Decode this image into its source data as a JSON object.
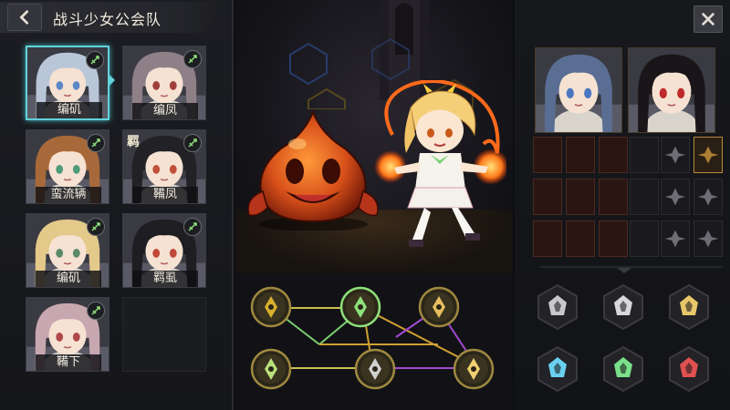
{
  "header": {
    "title": "战斗少女公会队"
  },
  "roster": [
    {
      "name": "编矶",
      "hair": "#b9c6d8",
      "eyes": "#5a88c8",
      "selected": true
    },
    {
      "name": "编凤",
      "hair": "#8f8088",
      "eyes": "#a0403a"
    },
    {
      "name": "蛮流辆",
      "hair": "#a8693a",
      "eyes": "#4e9b7a"
    },
    {
      "name": "鞴凤",
      "tag": "羁",
      "hair": "#222226",
      "eyes": "#c0503a"
    },
    {
      "name": "编矶",
      "hair": "#e3c98a",
      "eyes": "#5a8a6a"
    },
    {
      "name": "羁虱",
      "hair": "#1e1e22",
      "eyes": "#c04838"
    },
    {
      "name": "鞴下",
      "hair": "#c8a8b0",
      "eyes": "#b04848"
    }
  ],
  "team": [
    {
      "hair": "#5a6e94",
      "eyes": "#4a78c0"
    },
    {
      "hair": "#1a1518",
      "eyes": "#c02a2a"
    }
  ],
  "talents": [
    {
      "icon": "leaf-flame-icon",
      "color": "#d8b030",
      "active": false
    },
    {
      "icon": "arrow-gem-icon",
      "color": "#8ee07a",
      "active": true
    },
    {
      "icon": "crown-tower-icon",
      "color": "#e8c060",
      "active": false
    },
    {
      "icon": "sprout-icon",
      "color": "#b8e07a",
      "active": false
    },
    {
      "icon": "skull-shield-icon",
      "color": "#d0d0d0",
      "active": false
    },
    {
      "icon": "star-compass-icon",
      "color": "#f0d070",
      "active": false
    }
  ],
  "elements": [
    {
      "icon": "shield-heart-icon",
      "color": "#c8c8cc"
    },
    {
      "icon": "beast-head-icon",
      "color": "#d8d8dc"
    },
    {
      "icon": "quill-icon",
      "color": "#e8c66a"
    },
    {
      "icon": "snowflake-icon",
      "color": "#6ad0f0"
    },
    {
      "icon": "crystal-icon",
      "color": "#7ae08a"
    },
    {
      "icon": "blood-tree-icon",
      "color": "#e05050"
    }
  ]
}
